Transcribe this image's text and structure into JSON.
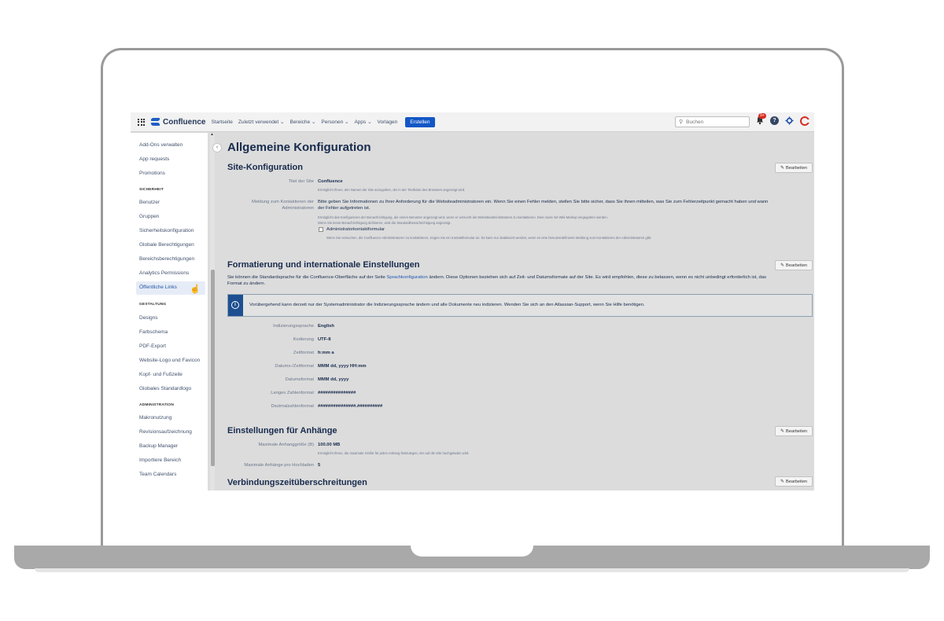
{
  "nav": {
    "logo": "Confluence",
    "items": [
      "Startseite",
      "Zuletzt verwendet ⌄",
      "Bereiche ⌄",
      "Personen ⌄",
      "Apps ⌄",
      "Vorlagen"
    ],
    "create": "Erstellen",
    "search_placeholder": "Buchen",
    "notification_count": "9+"
  },
  "sidebar": {
    "items": [
      "Add-Ons verwalten",
      "App requests",
      "Promotions"
    ],
    "security_heading": "SICHERHEIT",
    "security_items": [
      "Benutzer",
      "Gruppen",
      "Sicherheitskonfiguration",
      "Globale Berechtigungen",
      "Bereichsberechtigungen",
      "Analytics Permissions",
      "Öffentliche Links"
    ],
    "design_heading": "GESTALTUNG",
    "design_items": [
      "Designs",
      "Farbschema",
      "PDF-Export",
      "Website-Logo und Favicon",
      "Kopf- und Fußzeile",
      "Globales Standardlogo"
    ],
    "admin_heading": "ADMINISTRATION",
    "admin_items": [
      "Makronutzung",
      "Revisionsaufzeichnung",
      "Backup Manager",
      "Importiere Bereich",
      "Team Calendars"
    ]
  },
  "main": {
    "title": "Allgemeine Konfiguration",
    "edit_label": "Bearbeiten",
    "site": {
      "heading": "Site-Konfiguration",
      "site_title_label": "Titel der Site",
      "site_title_value": "Confluence",
      "site_title_hint": "Ermöglicht Ihnen, den Namen der Site anzugeben, der in der Titelleiste des Browsers angezeigt wird.",
      "contact_label_1": "Meldung zum Kontaktieren der",
      "contact_label_2": "Administratoren",
      "contact_value_1": "Bitte geben Sie Informationen zu Ihrer Anforderung für die Websiteadministratoren ein. Wenn Sie einen Fehler melden, stellen Sie bitte sicher, dass Sie ihnen mitteilen, was Sie zum Fehlerzeitpunkt gemacht haben und wann",
      "contact_value_2": "der Fehler aufgetreten ist.",
      "contact_hint_1": "Ermöglicht das Konfigurieren der Benachrichtigung, die einem Benutzer angezeigt wird, wenn er versucht die Websiteadministratoren zu kontaktieren. Dies muss mit Wiki-Markup eingegeben werden.",
      "contact_hint_2": "Wenn Sie keine Benachrichtigung definieren, wird die Standardbenachrichtigung angezeigt.",
      "checkbox_label": "Administratorkontaktformular",
      "checkbox_hint": "Wenn Sie versuchen, die Confluence-Administratoren zu kontaktieren, zeigen Sie ein Kontaktformular an. Es kann nur deaktiviert werden, wenn es eine benutzerdefinierte Meldung zum Kontaktieren der Administratoren gibt."
    },
    "format": {
      "heading": "Formatierung und internationale Einstellungen",
      "desc_1_pre": "Sie können die Standardsprache für die Confluence-Oberfläche auf der Seite",
      "desc_1_link": "Sprachkonfiguration",
      "desc_1_post": "ändern. Diese Optionen beziehen sich auf Zeit- und Datumsformate auf der Site. Es wird empfohlen, diese zu belassen, wenn es nicht unbedingt erforderlich ist, das",
      "desc_2": "Format zu ändern.",
      "info": "Vorübergehend kann derzeit nur der Systemadministrator die Indizierungssprache ändern und alle Dokumente neu indizieren. Wenden Sie sich an den Atlassian-Support, wenn Sie Hilfe benötigen.",
      "rows": [
        {
          "label": "Indizierungssprache",
          "value": "English"
        },
        {
          "label": "Kodierung",
          "value": "UTF-8"
        },
        {
          "label": "Zeitformat",
          "value": "h:mm a"
        },
        {
          "label": "Datums-/Zeitformat",
          "value": "MMM dd, yyyy HH:mm"
        },
        {
          "label": "Datumsformat",
          "value": "MMM dd, yyyy"
        },
        {
          "label": "Langes Zahlenformat",
          "value": "###############"
        },
        {
          "label": "Dezimalzahlenformat",
          "value": "###############.##########"
        }
      ]
    },
    "attachments": {
      "heading": "Einstellungen für Anhänge",
      "max_size_label": "Maximale Anhanggröße (B)",
      "max_size_value": "100.00 MB",
      "max_size_hint": "Ermöglicht Ihnen, die maximale Größe für jeden Anhang festzulegen, der auf die Site hochgeladen wird.",
      "max_count_label": "Maximale Anhänge pro Hochladen",
      "max_count_value": "5"
    },
    "timeouts": {
      "heading": "Verbindungszeitüberschreitungen"
    }
  }
}
